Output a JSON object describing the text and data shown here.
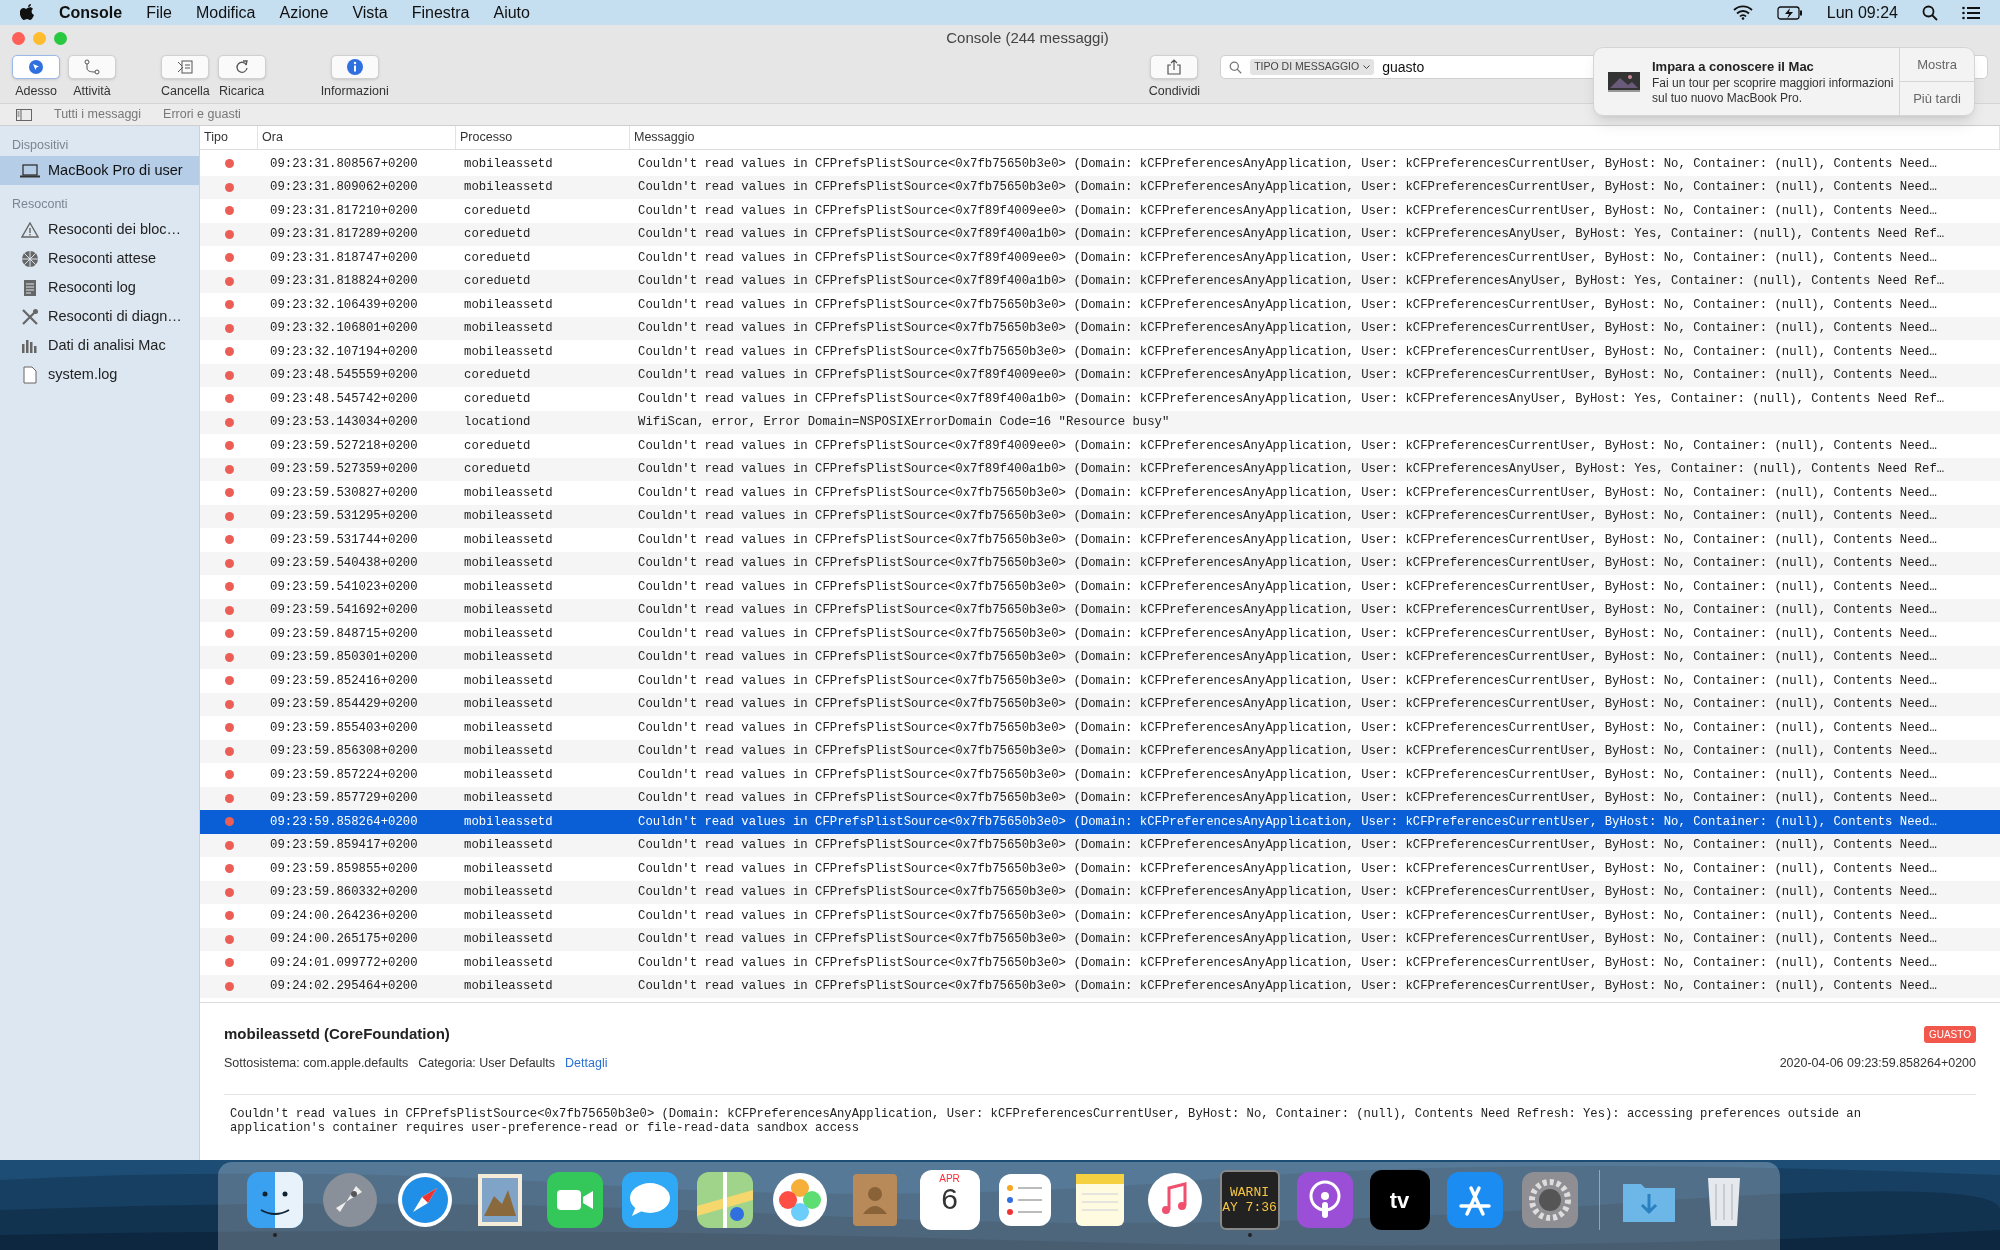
{
  "menu_bar": {
    "app": "Console",
    "menus": [
      "File",
      "Modifica",
      "Azione",
      "Vista",
      "Finestra",
      "Aiuto"
    ],
    "clock": "Lun 09:24"
  },
  "window": {
    "title": "Console (244 messaggi)"
  },
  "toolbar": {
    "buttons": [
      {
        "label": "Adesso",
        "kind": "now",
        "selected": true
      },
      {
        "label": "Attività",
        "kind": "activity",
        "selected": false
      },
      {
        "label": "Cancella",
        "kind": "clear",
        "selected": false
      },
      {
        "label": "Ricarica",
        "kind": "reload",
        "selected": false
      },
      {
        "label": "Informazioni",
        "kind": "info",
        "selected": false
      }
    ],
    "share": {
      "label": "Condividi"
    }
  },
  "search": {
    "token": "TIPO DI MESSAGGIO",
    "value": "guasto"
  },
  "filter_tabs": [
    "Tutti i messaggi",
    "Errori e guasti"
  ],
  "sidebar": {
    "sections": [
      {
        "title": "Dispositivi",
        "items": [
          {
            "label": "MacBook Pro di user",
            "kind": "laptop",
            "selected": true
          }
        ]
      },
      {
        "title": "Resoconti",
        "items": [
          {
            "label": "Resoconti dei bloc…",
            "kind": "warning",
            "selected": false
          },
          {
            "label": "Resoconti attese",
            "kind": "spinner",
            "selected": false
          },
          {
            "label": "Resoconti log",
            "kind": "doc",
            "selected": false
          },
          {
            "label": "Resoconti di diagn…",
            "kind": "tools",
            "selected": false
          },
          {
            "label": "Dati di analisi Mac",
            "kind": "bars",
            "selected": false
          },
          {
            "label": "system.log",
            "kind": "file",
            "selected": false
          }
        ]
      }
    ]
  },
  "table": {
    "columns": [
      "Tipo",
      "Ora",
      "Processo",
      "Messaggio"
    ],
    "rows": [
      {
        "kind": "error",
        "time": "09:23:31.808567+0200",
        "process": "mobileassetd",
        "message": "Couldn't read values in CFPrefsPlistSource<0x7fb75650b3e0> (Domain: kCFPreferencesAnyApplication, User: kCFPreferencesCurrentUser, ByHost: No, Container: (null), Contents Need…",
        "selected": false
      },
      {
        "kind": "error",
        "time": "09:23:31.809062+0200",
        "process": "mobileassetd",
        "message": "Couldn't read values in CFPrefsPlistSource<0x7fb75650b3e0> (Domain: kCFPreferencesAnyApplication, User: kCFPreferencesCurrentUser, ByHost: No, Container: (null), Contents Need…",
        "selected": false
      },
      {
        "kind": "error",
        "time": "09:23:31.817210+0200",
        "process": "coreduetd",
        "message": "Couldn't read values in CFPrefsPlistSource<0x7f89f4009ee0> (Domain: kCFPreferencesAnyApplication, User: kCFPreferencesCurrentUser, ByHost: No, Container: (null), Contents Need…",
        "selected": false
      },
      {
        "kind": "error",
        "time": "09:23:31.817289+0200",
        "process": "coreduetd",
        "message": "Couldn't read values in CFPrefsPlistSource<0x7f89f400a1b0> (Domain: kCFPreferencesAnyApplication, User: kCFPreferencesAnyUser, ByHost: Yes, Container: (null), Contents Need Ref…",
        "selected": false
      },
      {
        "kind": "error",
        "time": "09:23:31.818747+0200",
        "process": "coreduetd",
        "message": "Couldn't read values in CFPrefsPlistSource<0x7f89f4009ee0> (Domain: kCFPreferencesAnyApplication, User: kCFPreferencesCurrentUser, ByHost: No, Container: (null), Contents Need…",
        "selected": false
      },
      {
        "kind": "error",
        "time": "09:23:31.818824+0200",
        "process": "coreduetd",
        "message": "Couldn't read values in CFPrefsPlistSource<0x7f89f400a1b0> (Domain: kCFPreferencesAnyApplication, User: kCFPreferencesAnyUser, ByHost: Yes, Container: (null), Contents Need Ref…",
        "selected": false
      },
      {
        "kind": "error",
        "time": "09:23:32.106439+0200",
        "process": "mobileassetd",
        "message": "Couldn't read values in CFPrefsPlistSource<0x7fb75650b3e0> (Domain: kCFPreferencesAnyApplication, User: kCFPreferencesCurrentUser, ByHost: No, Container: (null), Contents Need…",
        "selected": false
      },
      {
        "kind": "error",
        "time": "09:23:32.106801+0200",
        "process": "mobileassetd",
        "message": "Couldn't read values in CFPrefsPlistSource<0x7fb75650b3e0> (Domain: kCFPreferencesAnyApplication, User: kCFPreferencesCurrentUser, ByHost: No, Container: (null), Contents Need…",
        "selected": false
      },
      {
        "kind": "error",
        "time": "09:23:32.107194+0200",
        "process": "mobileassetd",
        "message": "Couldn't read values in CFPrefsPlistSource<0x7fb75650b3e0> (Domain: kCFPreferencesAnyApplication, User: kCFPreferencesCurrentUser, ByHost: No, Container: (null), Contents Need…",
        "selected": false
      },
      {
        "kind": "error",
        "time": "09:23:48.545559+0200",
        "process": "coreduetd",
        "message": "Couldn't read values in CFPrefsPlistSource<0x7f89f4009ee0> (Domain: kCFPreferencesAnyApplication, User: kCFPreferencesCurrentUser, ByHost: No, Container: (null), Contents Need…",
        "selected": false
      },
      {
        "kind": "error",
        "time": "09:23:48.545742+0200",
        "process": "coreduetd",
        "message": "Couldn't read values in CFPrefsPlistSource<0x7f89f400a1b0> (Domain: kCFPreferencesAnyApplication, User: kCFPreferencesAnyUser, ByHost: Yes, Container: (null), Contents Need Ref…",
        "selected": false
      },
      {
        "kind": "error",
        "time": "09:23:53.143034+0200",
        "process": "locationd",
        "message": "WifiScan, error, Error Domain=NSPOSIXErrorDomain Code=16 \"Resource busy\"",
        "selected": false
      },
      {
        "kind": "error",
        "time": "09:23:59.527218+0200",
        "process": "coreduetd",
        "message": "Couldn't read values in CFPrefsPlistSource<0x7f89f4009ee0> (Domain: kCFPreferencesAnyApplication, User: kCFPreferencesCurrentUser, ByHost: No, Container: (null), Contents Need…",
        "selected": false
      },
      {
        "kind": "error",
        "time": "09:23:59.527359+0200",
        "process": "coreduetd",
        "message": "Couldn't read values in CFPrefsPlistSource<0x7f89f400a1b0> (Domain: kCFPreferencesAnyApplication, User: kCFPreferencesAnyUser, ByHost: Yes, Container: (null), Contents Need Ref…",
        "selected": false
      },
      {
        "kind": "error",
        "time": "09:23:59.530827+0200",
        "process": "mobileassetd",
        "message": "Couldn't read values in CFPrefsPlistSource<0x7fb75650b3e0> (Domain: kCFPreferencesAnyApplication, User: kCFPreferencesCurrentUser, ByHost: No, Container: (null), Contents Need…",
        "selected": false
      },
      {
        "kind": "error",
        "time": "09:23:59.531295+0200",
        "process": "mobileassetd",
        "message": "Couldn't read values in CFPrefsPlistSource<0x7fb75650b3e0> (Domain: kCFPreferencesAnyApplication, User: kCFPreferencesCurrentUser, ByHost: No, Container: (null), Contents Need…",
        "selected": false
      },
      {
        "kind": "error",
        "time": "09:23:59.531744+0200",
        "process": "mobileassetd",
        "message": "Couldn't read values in CFPrefsPlistSource<0x7fb75650b3e0> (Domain: kCFPreferencesAnyApplication, User: kCFPreferencesCurrentUser, ByHost: No, Container: (null), Contents Need…",
        "selected": false
      },
      {
        "kind": "error",
        "time": "09:23:59.540438+0200",
        "process": "mobileassetd",
        "message": "Couldn't read values in CFPrefsPlistSource<0x7fb75650b3e0> (Domain: kCFPreferencesAnyApplication, User: kCFPreferencesCurrentUser, ByHost: No, Container: (null), Contents Need…",
        "selected": false
      },
      {
        "kind": "error",
        "time": "09:23:59.541023+0200",
        "process": "mobileassetd",
        "message": "Couldn't read values in CFPrefsPlistSource<0x7fb75650b3e0> (Domain: kCFPreferencesAnyApplication, User: kCFPreferencesCurrentUser, ByHost: No, Container: (null), Contents Need…",
        "selected": false
      },
      {
        "kind": "error",
        "time": "09:23:59.541692+0200",
        "process": "mobileassetd",
        "message": "Couldn't read values in CFPrefsPlistSource<0x7fb75650b3e0> (Domain: kCFPreferencesAnyApplication, User: kCFPreferencesCurrentUser, ByHost: No, Container: (null), Contents Need…",
        "selected": false
      },
      {
        "kind": "error",
        "time": "09:23:59.848715+0200",
        "process": "mobileassetd",
        "message": "Couldn't read values in CFPrefsPlistSource<0x7fb75650b3e0> (Domain: kCFPreferencesAnyApplication, User: kCFPreferencesCurrentUser, ByHost: No, Container: (null), Contents Need…",
        "selected": false
      },
      {
        "kind": "error",
        "time": "09:23:59.850301+0200",
        "process": "mobileassetd",
        "message": "Couldn't read values in CFPrefsPlistSource<0x7fb75650b3e0> (Domain: kCFPreferencesAnyApplication, User: kCFPreferencesCurrentUser, ByHost: No, Container: (null), Contents Need…",
        "selected": false
      },
      {
        "kind": "error",
        "time": "09:23:59.852416+0200",
        "process": "mobileassetd",
        "message": "Couldn't read values in CFPrefsPlistSource<0x7fb75650b3e0> (Domain: kCFPreferencesAnyApplication, User: kCFPreferencesCurrentUser, ByHost: No, Container: (null), Contents Need…",
        "selected": false
      },
      {
        "kind": "error",
        "time": "09:23:59.854429+0200",
        "process": "mobileassetd",
        "message": "Couldn't read values in CFPrefsPlistSource<0x7fb75650b3e0> (Domain: kCFPreferencesAnyApplication, User: kCFPreferencesCurrentUser, ByHost: No, Container: (null), Contents Need…",
        "selected": false
      },
      {
        "kind": "error",
        "time": "09:23:59.855403+0200",
        "process": "mobileassetd",
        "message": "Couldn't read values in CFPrefsPlistSource<0x7fb75650b3e0> (Domain: kCFPreferencesAnyApplication, User: kCFPreferencesCurrentUser, ByHost: No, Container: (null), Contents Need…",
        "selected": false
      },
      {
        "kind": "error",
        "time": "09:23:59.856308+0200",
        "process": "mobileassetd",
        "message": "Couldn't read values in CFPrefsPlistSource<0x7fb75650b3e0> (Domain: kCFPreferencesAnyApplication, User: kCFPreferencesCurrentUser, ByHost: No, Container: (null), Contents Need…",
        "selected": false
      },
      {
        "kind": "error",
        "time": "09:23:59.857224+0200",
        "process": "mobileassetd",
        "message": "Couldn't read values in CFPrefsPlistSource<0x7fb75650b3e0> (Domain: kCFPreferencesAnyApplication, User: kCFPreferencesCurrentUser, ByHost: No, Container: (null), Contents Need…",
        "selected": false
      },
      {
        "kind": "error",
        "time": "09:23:59.857729+0200",
        "process": "mobileassetd",
        "message": "Couldn't read values in CFPrefsPlistSource<0x7fb75650b3e0> (Domain: kCFPreferencesAnyApplication, User: kCFPreferencesCurrentUser, ByHost: No, Container: (null), Contents Need…",
        "selected": false
      },
      {
        "kind": "error",
        "time": "09:23:59.858264+0200",
        "process": "mobileassetd",
        "message": "Couldn't read values in CFPrefsPlistSource<0x7fb75650b3e0> (Domain: kCFPreferencesAnyApplication, User: kCFPreferencesCurrentUser, ByHost: No, Container: (null), Contents Need…",
        "selected": true
      },
      {
        "kind": "error",
        "time": "09:23:59.859417+0200",
        "process": "mobileassetd",
        "message": "Couldn't read values in CFPrefsPlistSource<0x7fb75650b3e0> (Domain: kCFPreferencesAnyApplication, User: kCFPreferencesCurrentUser, ByHost: No, Container: (null), Contents Need…",
        "selected": false
      },
      {
        "kind": "error",
        "time": "09:23:59.859855+0200",
        "process": "mobileassetd",
        "message": "Couldn't read values in CFPrefsPlistSource<0x7fb75650b3e0> (Domain: kCFPreferencesAnyApplication, User: kCFPreferencesCurrentUser, ByHost: No, Container: (null), Contents Need…",
        "selected": false
      },
      {
        "kind": "error",
        "time": "09:23:59.860332+0200",
        "process": "mobileassetd",
        "message": "Couldn't read values in CFPrefsPlistSource<0x7fb75650b3e0> (Domain: kCFPreferencesAnyApplication, User: kCFPreferencesCurrentUser, ByHost: No, Container: (null), Contents Need…",
        "selected": false
      },
      {
        "kind": "error",
        "time": "09:24:00.264236+0200",
        "process": "mobileassetd",
        "message": "Couldn't read values in CFPrefsPlistSource<0x7fb75650b3e0> (Domain: kCFPreferencesAnyApplication, User: kCFPreferencesCurrentUser, ByHost: No, Container: (null), Contents Need…",
        "selected": false
      },
      {
        "kind": "error",
        "time": "09:24:00.265175+0200",
        "process": "mobileassetd",
        "message": "Couldn't read values in CFPrefsPlistSource<0x7fb75650b3e0> (Domain: kCFPreferencesAnyApplication, User: kCFPreferencesCurrentUser, ByHost: No, Container: (null), Contents Need…",
        "selected": false
      },
      {
        "kind": "error",
        "time": "09:24:01.099772+0200",
        "process": "mobileassetd",
        "message": "Couldn't read values in CFPrefsPlistSource<0x7fb75650b3e0> (Domain: kCFPreferencesAnyApplication, User: kCFPreferencesCurrentUser, ByHost: No, Container: (null), Contents Need…",
        "selected": false
      },
      {
        "kind": "error",
        "time": "09:24:02.295464+0200",
        "process": "mobileassetd",
        "message": "Couldn't read values in CFPrefsPlistSource<0x7fb75650b3e0> (Domain: kCFPreferencesAnyApplication, User: kCFPreferencesCurrentUser, ByHost: No, Container: (null), Contents Need…",
        "selected": false
      }
    ]
  },
  "details": {
    "title": "mobileassetd (CoreFoundation)",
    "badge": "GUASTO",
    "subsystem_label": "Sottosistema:",
    "subsystem": "com.apple.defaults",
    "category_label": "Categoria:",
    "category": "User Defaults",
    "link": "Dettagli",
    "timestamp": "2020-04-06 09:23:59.858264+0200",
    "message": "Couldn't read values in CFPrefsPlistSource<0x7fb75650b3e0> (Domain: kCFPreferencesAnyApplication, User: kCFPreferencesCurrentUser, ByHost: No, Container: (null), Contents Need Refresh: Yes): accessing preferences outside an application's container requires user-preference-read or file-read-data sandbox access"
  },
  "notification": {
    "title": "Impara a conoscere il Mac",
    "body": "Fai un tour per scoprire maggiori informazioni sul tuo nuovo MacBook Pro.",
    "actions": [
      "Mostra",
      "Più tardi"
    ]
  },
  "dock": {
    "items": [
      {
        "kind": "finder",
        "running": true
      },
      {
        "kind": "launchpad",
        "running": false
      },
      {
        "kind": "safari",
        "running": false
      },
      {
        "kind": "mail",
        "running": false
      },
      {
        "kind": "facetime",
        "running": false
      },
      {
        "kind": "messages",
        "running": false
      },
      {
        "kind": "maps",
        "running": false
      },
      {
        "kind": "photos",
        "running": false
      },
      {
        "kind": "contacts",
        "running": false
      },
      {
        "kind": "calendar",
        "running": false,
        "month": "APR",
        "day": "6"
      },
      {
        "kind": "reminders",
        "running": false
      },
      {
        "kind": "notes",
        "running": false
      },
      {
        "kind": "music",
        "running": false
      },
      {
        "kind": "console",
        "running": true,
        "lines": [
          "WARNI",
          "AY 7:36"
        ]
      },
      {
        "kind": "podcasts",
        "running": false
      },
      {
        "kind": "tv",
        "running": false,
        "text": "tv"
      },
      {
        "kind": "appstore",
        "running": false
      },
      {
        "kind": "settings",
        "running": false
      },
      {
        "kind": "separator",
        "running": false
      },
      {
        "kind": "downloads",
        "running": false
      },
      {
        "kind": "trash",
        "running": false
      }
    ]
  }
}
